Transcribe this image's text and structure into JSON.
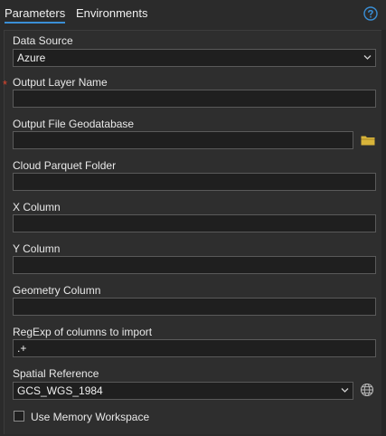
{
  "tabs": [
    {
      "label": "Parameters",
      "active": true
    },
    {
      "label": "Environments",
      "active": false
    }
  ],
  "help_icon": "question-circle-icon",
  "colors": {
    "accent": "#3a8fd6",
    "required": "#e0442c",
    "folder": "#d8b43a",
    "background": "#2b2b2b",
    "input_bg": "#1f1f1f"
  },
  "params": {
    "data_source": {
      "label": "Data Source",
      "value": "Azure"
    },
    "output_layer_name": {
      "label": "Output Layer Name",
      "required_marker": "*",
      "value": ""
    },
    "output_file_gdb": {
      "label": "Output File Geodatabase",
      "value": "",
      "browse_icon": "folder-icon"
    },
    "cloud_parquet_folder": {
      "label": "Cloud Parquet Folder",
      "value": ""
    },
    "x_column": {
      "label": "X Column",
      "value": ""
    },
    "y_column": {
      "label": "Y Column",
      "value": ""
    },
    "geometry_column": {
      "label": "Geometry Column",
      "value": ""
    },
    "regexp_columns": {
      "label": "RegExp of columns to import",
      "value": ".+"
    },
    "spatial_reference": {
      "label": "Spatial Reference",
      "value": "GCS_WGS_1984",
      "picker_icon": "globe-icon"
    },
    "use_memory_workspace": {
      "label": "Use Memory Workspace",
      "checked": false
    }
  }
}
